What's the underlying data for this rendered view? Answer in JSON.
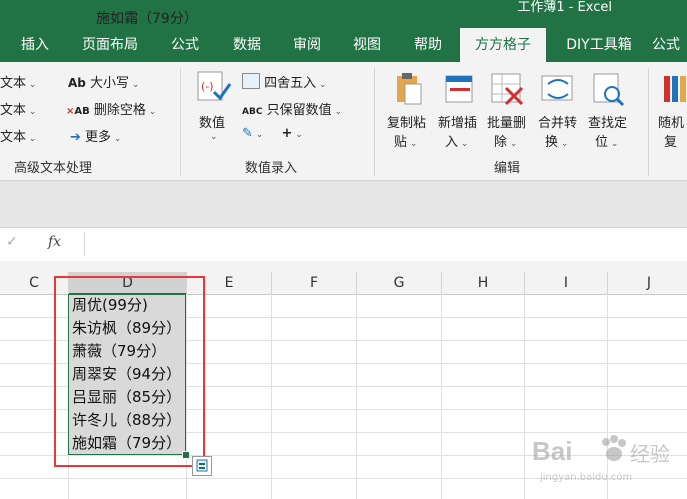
{
  "window": {
    "title": "工作薄1  -  Excel"
  },
  "tabs": [
    {
      "label": "插入"
    },
    {
      "label": "页面布局"
    },
    {
      "label": "公式"
    },
    {
      "label": "数据"
    },
    {
      "label": "审阅"
    },
    {
      "label": "视图"
    },
    {
      "label": "帮助"
    },
    {
      "label": "方方格子"
    },
    {
      "label": "DIY工具箱"
    },
    {
      "label": "公式"
    }
  ],
  "ribbon": {
    "text_group": {
      "items": [
        "文本",
        "文本",
        "文本"
      ],
      "upper_lower": "大小写",
      "delete_space": "删除空格",
      "more": "更多",
      "label": "高级文本处理"
    },
    "number_group": {
      "value_button": "数值",
      "round": "四舍五入",
      "keep_values": "只保留数值",
      "label": "数值录入"
    },
    "edit_group": {
      "buttons": [
        {
          "line1": "复制粘",
          "line2": "贴"
        },
        {
          "line1": "新增插",
          "line2": "入"
        },
        {
          "line1": "批量删",
          "line2": "除"
        },
        {
          "line1": "合并转",
          "line2": "换"
        },
        {
          "line1": "查找定",
          "line2": "位"
        }
      ],
      "label": "编辑"
    },
    "random_group": {
      "line1": "随机",
      "line2": "复"
    }
  },
  "formula_bar": {
    "cancel": "✓",
    "fx": "fx",
    "content": "施如霜（79分）"
  },
  "columns": [
    "C",
    "D",
    "E",
    "F",
    "G",
    "H",
    "I",
    "J"
  ],
  "cells": [
    "周优(99分)",
    "朱访枫（89分）",
    "萧薇（79分）",
    "周翠安（94分）",
    "吕显丽（85分）",
    "许冬儿（88分）",
    "施如霜（79分）"
  ],
  "watermark": {
    "brand": "Bai",
    "brand2": "经验",
    "url": "jingyan.baidu.com"
  }
}
